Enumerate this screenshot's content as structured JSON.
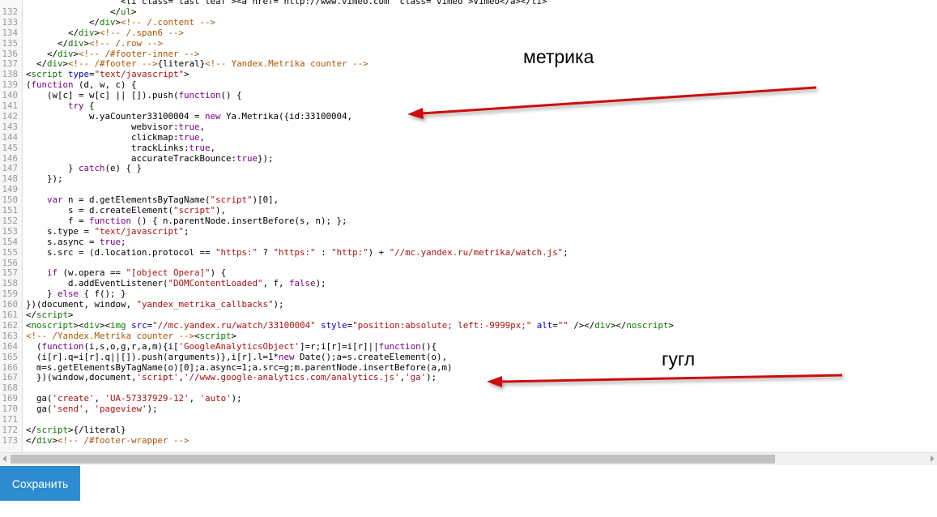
{
  "editor": {
    "lines": [
      {
        "n": "",
        "h": [
          [
            "",
            "                  <li class=\"last leaf\"><a href=\"http://www.vimeo.com\" class=\"vimeo\">Vimeo</a></li>"
          ]
        ]
      },
      {
        "n": "132",
        "h": [
          [
            "",
            "                </"
          ],
          [
            "t",
            "ul"
          ],
          [
            "",
            ">"
          ]
        ]
      },
      {
        "n": "133",
        "h": [
          [
            "",
            "            </"
          ],
          [
            "t",
            "div"
          ],
          [
            "",
            ">"
          ],
          [
            "c",
            "<!-- /.content -->"
          ]
        ]
      },
      {
        "n": "134",
        "h": [
          [
            "",
            "        </"
          ],
          [
            "t",
            "div"
          ],
          [
            "",
            ">"
          ],
          [
            "c",
            "<!-- /.span6 -->"
          ]
        ]
      },
      {
        "n": "135",
        "h": [
          [
            "",
            "      </"
          ],
          [
            "t",
            "div"
          ],
          [
            "",
            ">"
          ],
          [
            "c",
            "<!-- /.row -->"
          ]
        ]
      },
      {
        "n": "136",
        "h": [
          [
            "",
            "    </"
          ],
          [
            "t",
            "div"
          ],
          [
            "",
            ">"
          ],
          [
            "c",
            "<!-- /#footer-inner -->"
          ]
        ]
      },
      {
        "n": "137",
        "h": [
          [
            "",
            "  </"
          ],
          [
            "t",
            "div"
          ],
          [
            "",
            ">"
          ],
          [
            "c",
            "<!-- /#footer -->"
          ],
          [
            "",
            "{literal}"
          ],
          [
            "c",
            "<!-- Yandex.Metrika counter -->"
          ]
        ]
      },
      {
        "n": "138",
        "h": [
          [
            "",
            "<"
          ],
          [
            "t",
            "script"
          ],
          [
            "",
            " "
          ],
          [
            "a",
            "type"
          ],
          [
            "",
            "="
          ],
          [
            "s",
            "\"text/javascript\""
          ],
          [
            "",
            ">"
          ]
        ]
      },
      {
        "n": "139",
        "h": [
          [
            "",
            "("
          ],
          [
            "k",
            "function"
          ],
          [
            "",
            " (d, w, c) {"
          ]
        ]
      },
      {
        "n": "140",
        "h": [
          [
            "",
            "    (w[c] = w[c] || []).push("
          ],
          [
            "k",
            "function"
          ],
          [
            "",
            "() {"
          ]
        ]
      },
      {
        "n": "141",
        "h": [
          [
            "",
            "        "
          ],
          [
            "k",
            "try"
          ],
          [
            "",
            " {"
          ]
        ]
      },
      {
        "n": "142",
        "h": [
          [
            "",
            "            w.yaCounter33100004 = "
          ],
          [
            "k",
            "new"
          ],
          [
            "",
            " Ya.Metrika({id:33100004,"
          ]
        ]
      },
      {
        "n": "143",
        "h": [
          [
            "",
            "                    webvisor:"
          ],
          [
            "k",
            "true"
          ],
          [
            "",
            ","
          ]
        ]
      },
      {
        "n": "144",
        "h": [
          [
            "",
            "                    clickmap:"
          ],
          [
            "k",
            "true"
          ],
          [
            "",
            ","
          ]
        ]
      },
      {
        "n": "145",
        "h": [
          [
            "",
            "                    trackLinks:"
          ],
          [
            "k",
            "true"
          ],
          [
            "",
            ","
          ]
        ]
      },
      {
        "n": "146",
        "h": [
          [
            "",
            "                    accurateTrackBounce:"
          ],
          [
            "k",
            "true"
          ],
          [
            "",
            "});"
          ]
        ]
      },
      {
        "n": "147",
        "h": [
          [
            "",
            "        } "
          ],
          [
            "k",
            "catch"
          ],
          [
            "",
            "(e) { }"
          ]
        ]
      },
      {
        "n": "148",
        "h": [
          [
            "",
            "    });"
          ]
        ]
      },
      {
        "n": "149",
        "h": [
          [
            "",
            ""
          ]
        ]
      },
      {
        "n": "150",
        "h": [
          [
            "",
            "    "
          ],
          [
            "k",
            "var"
          ],
          [
            "",
            " n = d.getElementsByTagName("
          ],
          [
            "s",
            "\"script\""
          ],
          [
            "",
            ")[0],"
          ]
        ]
      },
      {
        "n": "151",
        "h": [
          [
            "",
            "        s = d.createElement("
          ],
          [
            "s",
            "\"script\""
          ],
          [
            "",
            "),"
          ]
        ]
      },
      {
        "n": "152",
        "h": [
          [
            "",
            "        f = "
          ],
          [
            "k",
            "function"
          ],
          [
            "",
            " () { n.parentNode.insertBefore(s, n); };"
          ]
        ]
      },
      {
        "n": "153",
        "h": [
          [
            "",
            "    s.type = "
          ],
          [
            "s",
            "\"text/javascript\""
          ],
          [
            "",
            ";"
          ]
        ]
      },
      {
        "n": "154",
        "h": [
          [
            "",
            "    s.async = "
          ],
          [
            "k",
            "true"
          ],
          [
            "",
            ";"
          ]
        ]
      },
      {
        "n": "155",
        "h": [
          [
            "",
            "    s.src = (d.location.protocol == "
          ],
          [
            "s",
            "\"https:\""
          ],
          [
            "",
            " ? "
          ],
          [
            "s",
            "\"https:\""
          ],
          [
            "",
            " : "
          ],
          [
            "s",
            "\"http:\""
          ],
          [
            "",
            ") + "
          ],
          [
            "s",
            "\"//mc.yandex.ru/metrika/watch.js\""
          ],
          [
            "",
            ";"
          ]
        ]
      },
      {
        "n": "156",
        "h": [
          [
            "",
            ""
          ]
        ]
      },
      {
        "n": "157",
        "h": [
          [
            "",
            "    "
          ],
          [
            "k",
            "if"
          ],
          [
            "",
            " (w.opera == "
          ],
          [
            "s",
            "\"[object Opera]\""
          ],
          [
            "",
            ") {"
          ]
        ]
      },
      {
        "n": "158",
        "h": [
          [
            "",
            "        d.addEventListener("
          ],
          [
            "s",
            "\"DOMContentLoaded\""
          ],
          [
            "",
            ", f, "
          ],
          [
            "k",
            "false"
          ],
          [
            "",
            ");"
          ]
        ]
      },
      {
        "n": "159",
        "h": [
          [
            "",
            "    } "
          ],
          [
            "k",
            "else"
          ],
          [
            "",
            " { f(); }"
          ]
        ]
      },
      {
        "n": "160",
        "h": [
          [
            "",
            "})(document, window, "
          ],
          [
            "s",
            "\"yandex_metrika_callbacks\""
          ],
          [
            "",
            ");"
          ]
        ]
      },
      {
        "n": "161",
        "h": [
          [
            "",
            "</"
          ],
          [
            "t",
            "script"
          ],
          [
            "",
            ">"
          ]
        ]
      },
      {
        "n": "162",
        "h": [
          [
            "",
            "<"
          ],
          [
            "t",
            "noscript"
          ],
          [
            "",
            "><"
          ],
          [
            "t",
            "div"
          ],
          [
            "",
            "><"
          ],
          [
            "t",
            "img"
          ],
          [
            "",
            " "
          ],
          [
            "a",
            "src"
          ],
          [
            "",
            "="
          ],
          [
            "s",
            "\"//mc.yandex.ru/watch/33100004\""
          ],
          [
            "",
            " "
          ],
          [
            "a",
            "style"
          ],
          [
            "",
            "="
          ],
          [
            "s",
            "\"position:absolute; left:-9999px;\""
          ],
          [
            "",
            " "
          ],
          [
            "a",
            "alt"
          ],
          [
            "",
            "="
          ],
          [
            "s",
            "\"\""
          ],
          [
            "",
            " /></"
          ],
          [
            "t",
            "div"
          ],
          [
            "",
            "></"
          ],
          [
            "t",
            "noscript"
          ],
          [
            "",
            ">"
          ]
        ]
      },
      {
        "n": "163",
        "h": [
          [
            "c",
            "<!-- /Yandex.Metrika counter -->"
          ],
          [
            "",
            "<"
          ],
          [
            "t",
            "script"
          ],
          [
            "",
            ">"
          ]
        ]
      },
      {
        "n": "164",
        "h": [
          [
            "",
            "  ("
          ],
          [
            "k",
            "function"
          ],
          [
            "",
            "(i,s,o,g,r,a,m){i["
          ],
          [
            "s",
            "'GoogleAnalyticsObject'"
          ],
          [
            "",
            "]=r;i[r]=i[r]||"
          ],
          [
            "k",
            "function"
          ],
          [
            "",
            "(){"
          ]
        ]
      },
      {
        "n": "165",
        "h": [
          [
            "",
            "  (i[r].q=i[r].q||[]).push(arguments)},i[r].l=1*"
          ],
          [
            "k",
            "new"
          ],
          [
            "",
            " Date();a=s.createElement(o),"
          ]
        ]
      },
      {
        "n": "166",
        "h": [
          [
            "",
            "  m=s.getElementsByTagName(o)[0];a.async=1;a.src=g;m.parentNode.insertBefore(a,m)"
          ]
        ]
      },
      {
        "n": "167",
        "h": [
          [
            "",
            "  })(window,document,"
          ],
          [
            "s",
            "'script'"
          ],
          [
            "",
            ","
          ],
          [
            "s",
            "'//www.google-analytics.com/analytics.js'"
          ],
          [
            "",
            ","
          ],
          [
            "s",
            "'ga'"
          ],
          [
            "",
            ");"
          ]
        ]
      },
      {
        "n": "168",
        "h": [
          [
            "",
            ""
          ]
        ]
      },
      {
        "n": "169",
        "h": [
          [
            "",
            "  ga("
          ],
          [
            "s",
            "'create'"
          ],
          [
            "",
            ", "
          ],
          [
            "s",
            "'UA-57337929-12'"
          ],
          [
            "",
            ", "
          ],
          [
            "s",
            "'auto'"
          ],
          [
            "",
            ");"
          ]
        ]
      },
      {
        "n": "170",
        "h": [
          [
            "",
            "  ga("
          ],
          [
            "s",
            "'send'"
          ],
          [
            "",
            ", "
          ],
          [
            "s",
            "'pageview'"
          ],
          [
            "",
            ");"
          ]
        ]
      },
      {
        "n": "171",
        "h": [
          [
            "",
            ""
          ]
        ]
      },
      {
        "n": "172",
        "h": [
          [
            "",
            "</"
          ],
          [
            "t",
            "script"
          ],
          [
            "",
            ">{/literal}"
          ]
        ]
      },
      {
        "n": "173",
        "h": [
          [
            "",
            "</"
          ],
          [
            "t",
            "div"
          ],
          [
            "",
            ">"
          ],
          [
            "c",
            "<!-- /#footer-wrapper -->"
          ]
        ]
      }
    ]
  },
  "annotations": {
    "metrika": "метрика",
    "google": "гугл",
    "arrow_color": "#cc1111"
  },
  "actions": {
    "save_label": "Сохранить"
  },
  "colors": {
    "tag": "#117700",
    "keyword": "#770088",
    "string": "#aa1111",
    "attribute": "#0000cc",
    "comment": "#aa5500",
    "save_button": "#2d8ccf"
  }
}
